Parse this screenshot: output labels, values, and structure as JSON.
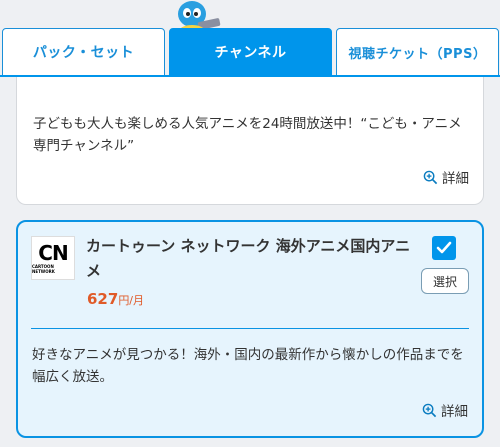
{
  "tabs": [
    {
      "label": "パック・セット",
      "active": false
    },
    {
      "label": "チャンネル",
      "active": true
    },
    {
      "label": "視聴チケット（PPS）",
      "active": false
    }
  ],
  "cards": [
    {
      "description": "子どもも大人も楽しめる人気アニメを24時間放送中！“こども・アニメ専門チャンネル”",
      "detail_label": "詳細"
    },
    {
      "logo_text": "CN",
      "logo_subtext": "CARTOON NETWORK",
      "name": "カートゥーン ネットワーク 海外アニメ国内アニメ",
      "price_amount": "627",
      "price_unit": "円/月",
      "selected": true,
      "select_label": "選択",
      "description": "好きなアニメが見つかる！海外・国内の最新作から懐かしの作品までを幅広く放送。",
      "detail_label": "詳細"
    }
  ],
  "colors": {
    "accent": "#0095eb",
    "price": "#e05a28",
    "selected_card_bg": "#e6f4fd"
  },
  "icons": {
    "mascot": "mascot-icon",
    "detail": "zoom-in-icon",
    "check": "check-icon"
  }
}
